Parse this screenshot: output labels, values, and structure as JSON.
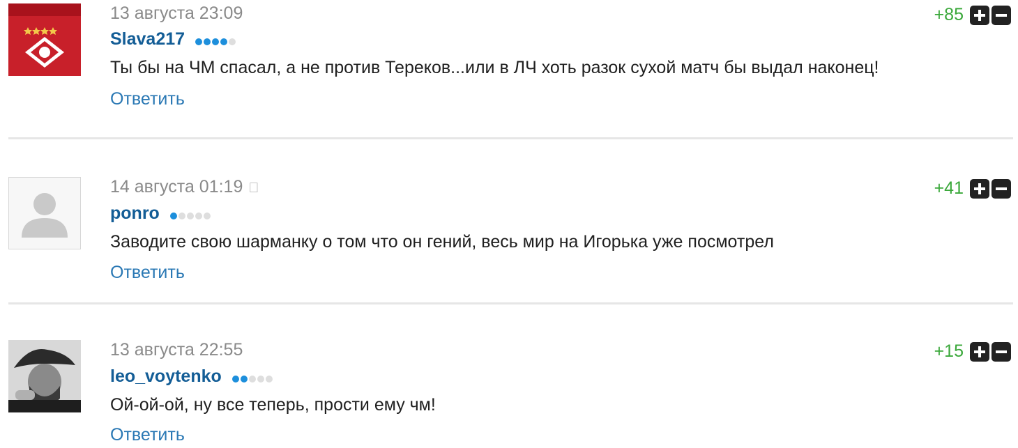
{
  "comments": [
    {
      "date": "13 августа 23:09",
      "username": "Slava217",
      "rating_dots_filled": 4,
      "rating_dots_total": 5,
      "text": "Ты бы на ЧМ спасал, а не против Тереков...или в ЛЧ хоть разок сухой матч бы выдал наконец!",
      "reply_label": "Ответить",
      "score": "+85",
      "avatar": "spartak-logo-icon",
      "device_icon": null
    },
    {
      "date": "14 августа 01:19",
      "username": "ponro",
      "rating_dots_filled": 1,
      "rating_dots_total": 5,
      "text": "Заводите свою шарманку о том что он гений, весь мир на Игорька уже посмотрел",
      "reply_label": "Ответить",
      "score": "+41",
      "avatar": "default-user-icon",
      "device_icon": "apple-icon"
    },
    {
      "date": "13 августа 22:55",
      "username": "leo_voytenko",
      "rating_dots_filled": 2,
      "rating_dots_total": 5,
      "text": "Ой-ой-ой, ну все теперь, прости ему чм!",
      "reply_label": "Ответить",
      "score": "+15",
      "avatar": "user-photo-icon",
      "device_icon": null
    }
  ],
  "colors": {
    "score": "#3aa83a",
    "username": "#135d96",
    "reply": "#2a78b4",
    "date": "#8a8a8a",
    "dot_active": "#1d8fdc"
  }
}
